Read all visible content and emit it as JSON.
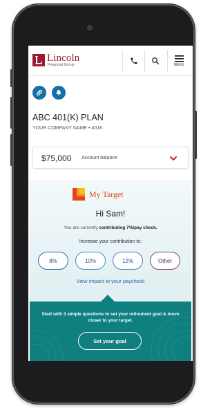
{
  "header": {
    "brand_name": "Lincoln",
    "brand_sub": "Financial Group",
    "phone_icon": "phone-icon",
    "search_icon": "search-icon",
    "menu_icon": "hamburger-menu-icon",
    "menu_label": "MENU"
  },
  "quick_actions": [
    {
      "icon": "link-icon"
    },
    {
      "icon": "bell-icon"
    }
  ],
  "plan": {
    "title": "ABC 401(K) PLAN",
    "subtitle": "YOUR COMPANY NAME • 401K"
  },
  "balance": {
    "amount": "$75,000",
    "label": "Account balance",
    "toggle_icon": "chevron-down-icon"
  },
  "target": {
    "title": "My Target",
    "greeting": "Hi Sam!",
    "contrib_prefix": "You are currently ",
    "contrib_highlight": "contributing 7%/pay check.",
    "increase_label": "Increase your contribution to:",
    "options": [
      "8%",
      "10%",
      "12%",
      "Other"
    ],
    "impact_link": "View impact to your paycheck"
  },
  "cta": {
    "text": "Start with 3 simple questions to set your retirement goal & move closer to your target.",
    "button": "Set your goal"
  },
  "colors": {
    "brand_red": "#9b1c31",
    "accent_blue": "#1570a8",
    "target_orange": "#d6471a",
    "cta_teal": "#0f7f80"
  }
}
